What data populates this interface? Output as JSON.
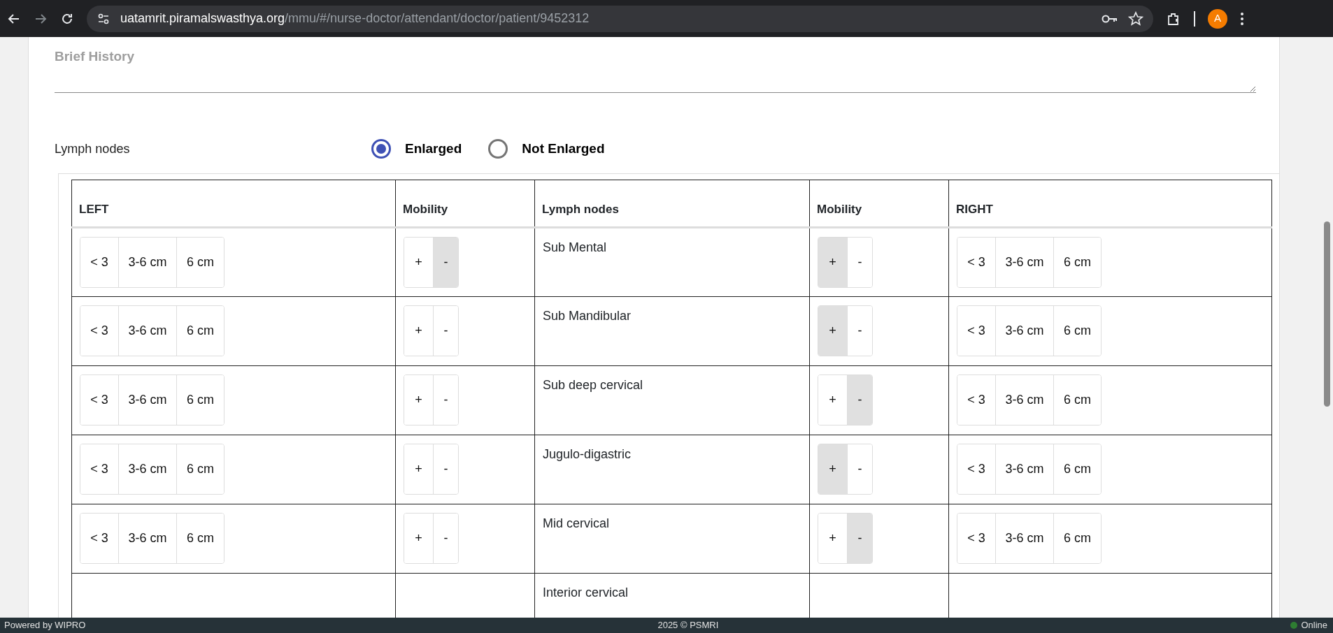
{
  "browser": {
    "url_host": "uatamrit.piramalswasthya.org",
    "url_path": "/mmu/#/nurse-doctor/attendant/doctor/patient/9452312",
    "profile_initial": "A"
  },
  "brief_history": {
    "placeholder": "Brief History"
  },
  "lymph_nodes": {
    "label": "Lymph nodes",
    "options": [
      {
        "label": "Enlarged",
        "selected": true
      },
      {
        "label": "Not Enlarged",
        "selected": false
      }
    ]
  },
  "table": {
    "columns": [
      "LEFT",
      "Mobility",
      "Lymph nodes",
      "Mobility",
      "RIGHT"
    ],
    "rows": [
      {
        "name": "Sub Mental",
        "left_size": [
          {
            "label": "< 3",
            "selected": false
          },
          {
            "label": "3-6 cm",
            "selected": false
          },
          {
            "label": "6 cm",
            "selected": false
          }
        ],
        "left_mobility": [
          {
            "label": "+",
            "selected": false
          },
          {
            "label": "-",
            "selected": true
          }
        ],
        "right_mobility": [
          {
            "label": "+",
            "selected": true
          },
          {
            "label": "-",
            "selected": false
          }
        ],
        "right_size": [
          {
            "label": "< 3",
            "selected": false
          },
          {
            "label": "3-6 cm",
            "selected": false
          },
          {
            "label": "6 cm",
            "selected": false
          }
        ]
      },
      {
        "name": "Sub Mandibular",
        "left_size": [
          {
            "label": "< 3",
            "selected": false
          },
          {
            "label": "3-6 cm",
            "selected": false
          },
          {
            "label": "6 cm",
            "selected": false
          }
        ],
        "left_mobility": [
          {
            "label": "+",
            "selected": false
          },
          {
            "label": "-",
            "selected": false
          }
        ],
        "right_mobility": [
          {
            "label": "+",
            "selected": true
          },
          {
            "label": "-",
            "selected": false
          }
        ],
        "right_size": [
          {
            "label": "< 3",
            "selected": false
          },
          {
            "label": "3-6 cm",
            "selected": false
          },
          {
            "label": "6 cm",
            "selected": false
          }
        ]
      },
      {
        "name": "Sub deep cervical",
        "left_size": [
          {
            "label": "< 3",
            "selected": false
          },
          {
            "label": "3-6 cm",
            "selected": false
          },
          {
            "label": "6 cm",
            "selected": false
          }
        ],
        "left_mobility": [
          {
            "label": "+",
            "selected": false
          },
          {
            "label": "-",
            "selected": false
          }
        ],
        "right_mobility": [
          {
            "label": "+",
            "selected": false
          },
          {
            "label": "-",
            "selected": true
          }
        ],
        "right_size": [
          {
            "label": "< 3",
            "selected": false
          },
          {
            "label": "3-6 cm",
            "selected": false
          },
          {
            "label": "6 cm",
            "selected": false
          }
        ]
      },
      {
        "name": "Jugulo-digastric",
        "left_size": [
          {
            "label": "< 3",
            "selected": false
          },
          {
            "label": "3-6 cm",
            "selected": false
          },
          {
            "label": "6 cm",
            "selected": false
          }
        ],
        "left_mobility": [
          {
            "label": "+",
            "selected": false
          },
          {
            "label": "-",
            "selected": false
          }
        ],
        "right_mobility": [
          {
            "label": "+",
            "selected": true
          },
          {
            "label": "-",
            "selected": false
          }
        ],
        "right_size": [
          {
            "label": "< 3",
            "selected": false
          },
          {
            "label": "3-6 cm",
            "selected": false
          },
          {
            "label": "6 cm",
            "selected": false
          }
        ]
      },
      {
        "name": "Mid cervical",
        "left_size": [
          {
            "label": "< 3",
            "selected": false
          },
          {
            "label": "3-6 cm",
            "selected": false
          },
          {
            "label": "6 cm",
            "selected": false
          }
        ],
        "left_mobility": [
          {
            "label": "+",
            "selected": false
          },
          {
            "label": "-",
            "selected": false
          }
        ],
        "right_mobility": [
          {
            "label": "+",
            "selected": false
          },
          {
            "label": "-",
            "selected": true
          }
        ],
        "right_size": [
          {
            "label": "< 3",
            "selected": false
          },
          {
            "label": "3-6 cm",
            "selected": false
          },
          {
            "label": "6 cm",
            "selected": false
          }
        ]
      },
      {
        "name": "Interior cervical"
      }
    ]
  },
  "footer": {
    "left": "Powered by WIPRO",
    "center": "2025 © PSMRI",
    "right": "Online"
  }
}
